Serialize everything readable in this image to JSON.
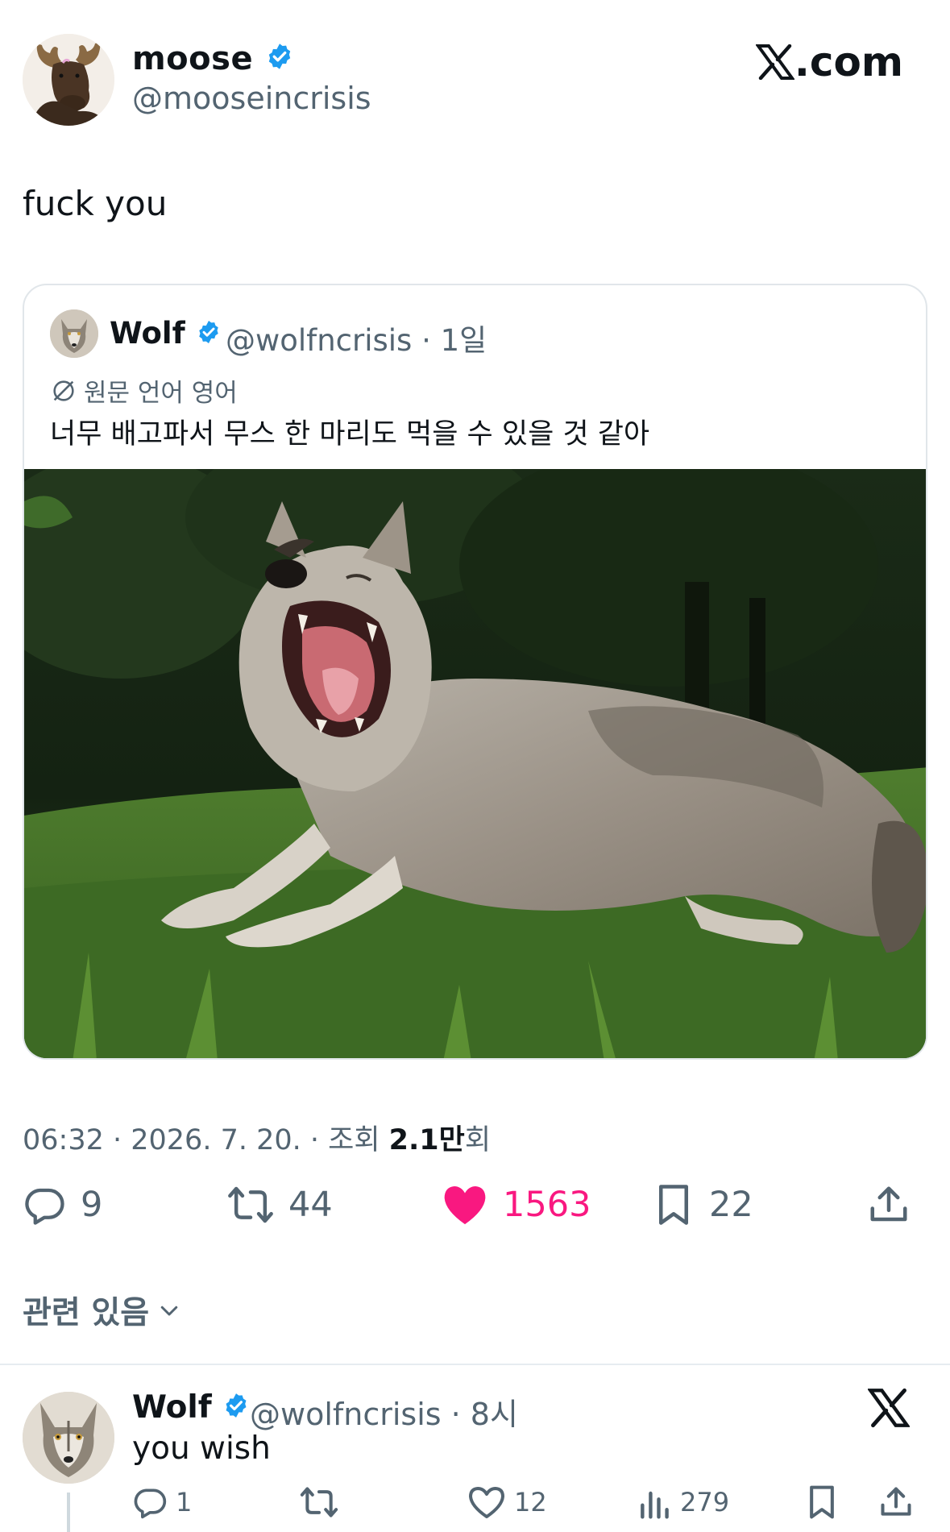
{
  "author": {
    "display_name": "moose",
    "handle": "@mooseincrisis",
    "avatar_icon": "moose-avatar"
  },
  "brand": {
    "label": "X.com",
    "x_glyph": "𝕏",
    "suffix": ".com"
  },
  "tweet": {
    "text": "fuck you"
  },
  "quote": {
    "display_name": "Wolf",
    "handle": "@wolfncrisis · 1일",
    "translation_label": "원문 언어 영어",
    "text": "너무 배고파서 무스 한 마리도 먹을 수 있을 것 같아",
    "image_icon": "yawning-wolf-photo"
  },
  "meta": {
    "time_date": "06:32 · 2026. 7. 20. · 조회 ",
    "views_bold": "2.1만",
    "views_suffix": "회"
  },
  "actions": {
    "replies": "9",
    "retweets": "44",
    "likes": "1563",
    "bookmarks": "22"
  },
  "related": {
    "label": "관련 있음"
  },
  "reply": {
    "display_name": "Wolf",
    "handle": "@wolfncrisis · 8시",
    "text": "you wish",
    "replies": "1",
    "likes": "12",
    "views": "279"
  },
  "colors": {
    "text": "#0f1419",
    "secondary": "#536471",
    "verified": "#1d9bf0",
    "like": "#f91880",
    "border": "#e1e6ea"
  }
}
